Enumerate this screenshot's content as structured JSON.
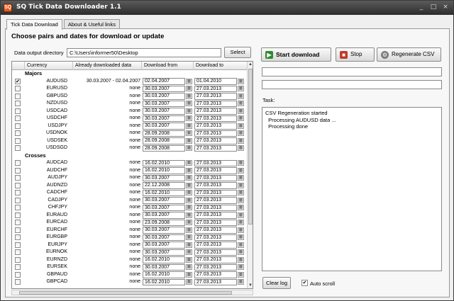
{
  "window": {
    "title": "SQ Tick Data Downloader 1.1",
    "app_icon": "SQ"
  },
  "window_controls": {
    "minimize": "_",
    "maximize": "□",
    "close": "×"
  },
  "tabs": [
    {
      "label": "Tick Data Download",
      "active": true
    },
    {
      "label": "About & Useful links",
      "active": false
    }
  ],
  "main": {
    "heading": "Choose pairs and dates for download or update",
    "output_dir_label": "Data output directory",
    "output_dir_value": "C:\\Users\\informer50\\Desktop",
    "select_button": "Select"
  },
  "grid": {
    "columns": [
      "Currency",
      "Already downloaded data",
      "Download from",
      "Download to"
    ],
    "groups": [
      {
        "name": "Majors",
        "rows": [
          {
            "checked": true,
            "currency": "AUDUSD",
            "downloaded": "30.03.2007 - 02.04.2007",
            "from": "02.04.2007",
            "to": "01.04.2010"
          },
          {
            "checked": false,
            "currency": "EURUSD",
            "downloaded": "none",
            "from": "30.03.2007",
            "to": "27.03.2013"
          },
          {
            "checked": false,
            "currency": "GBPUSD",
            "downloaded": "none",
            "from": "30.03.2007",
            "to": "27.03.2013"
          },
          {
            "checked": false,
            "currency": "NZDUSD",
            "downloaded": "none",
            "from": "30.03.2007",
            "to": "27.03.2013"
          },
          {
            "checked": false,
            "currency": "USDCAD",
            "downloaded": "none",
            "from": "30.03.2007",
            "to": "27.03.2013"
          },
          {
            "checked": false,
            "currency": "USDCHF",
            "downloaded": "none",
            "from": "30.03.2007",
            "to": "27.03.2013"
          },
          {
            "checked": false,
            "currency": "USDJPY",
            "downloaded": "none",
            "from": "30.03.2007",
            "to": "27.03.2013"
          },
          {
            "checked": false,
            "currency": "USDNOK",
            "downloaded": "none",
            "from": "28.09.2008",
            "to": "27.03.2013"
          },
          {
            "checked": false,
            "currency": "USDSEK",
            "downloaded": "none",
            "from": "28.09.2008",
            "to": "27.03.2013"
          },
          {
            "checked": false,
            "currency": "USDSGD",
            "downloaded": "none",
            "from": "28.09.2008",
            "to": "27.03.2013"
          }
        ]
      },
      {
        "name": "Crosses",
        "rows": [
          {
            "checked": false,
            "currency": "AUDCAD",
            "downloaded": "none",
            "from": "16.02.2010",
            "to": "27.03.2013"
          },
          {
            "checked": false,
            "currency": "AUDCHF",
            "downloaded": "none",
            "from": "16.02.2010",
            "to": "27.03.2013"
          },
          {
            "checked": false,
            "currency": "AUDJPY",
            "downloaded": "none",
            "from": "30.03.2007",
            "to": "27.03.2013"
          },
          {
            "checked": false,
            "currency": "AUDNZD",
            "downloaded": "none",
            "from": "22.12.2008",
            "to": "27.03.2013"
          },
          {
            "checked": false,
            "currency": "CADCHF",
            "downloaded": "none",
            "from": "16.02.2010",
            "to": "27.03.2013"
          },
          {
            "checked": false,
            "currency": "CADJPY",
            "downloaded": "none",
            "from": "30.03.2007",
            "to": "27.03.2013"
          },
          {
            "checked": false,
            "currency": "CHFJPY",
            "downloaded": "none",
            "from": "30.03.2007",
            "to": "27.03.2013"
          },
          {
            "checked": false,
            "currency": "EURAUD",
            "downloaded": "none",
            "from": "30.03.2007",
            "to": "27.03.2013"
          },
          {
            "checked": false,
            "currency": "EURCAD",
            "downloaded": "none",
            "from": "23.09.2008",
            "to": "27.03.2013"
          },
          {
            "checked": false,
            "currency": "EURCHF",
            "downloaded": "none",
            "from": "30.03.2007",
            "to": "27.03.2013"
          },
          {
            "checked": false,
            "currency": "EURGBP",
            "downloaded": "none",
            "from": "30.03.2007",
            "to": "27.03.2013"
          },
          {
            "checked": false,
            "currency": "EURJPY",
            "downloaded": "none",
            "from": "30.03.2007",
            "to": "27.03.2013"
          },
          {
            "checked": false,
            "currency": "EURNOK",
            "downloaded": "none",
            "from": "30.03.2007",
            "to": "27.03.2013"
          },
          {
            "checked": false,
            "currency": "EURNZD",
            "downloaded": "none",
            "from": "16.02.2010",
            "to": "27.03.2013"
          },
          {
            "checked": false,
            "currency": "EURSEK",
            "downloaded": "none",
            "from": "30.03.2007",
            "to": "27.03.2013"
          },
          {
            "checked": false,
            "currency": "GBPAUD",
            "downloaded": "none",
            "from": "16.02.2010",
            "to": "27.03.2013"
          },
          {
            "checked": false,
            "currency": "GBPCAD",
            "downloaded": "none",
            "from": "16.02.2010",
            "to": "27.03.2013"
          }
        ]
      }
    ]
  },
  "actions": {
    "start_label": "Start download",
    "stop_label": "Stop",
    "regen_label": "Regenerate CSV",
    "start_icon": "play-icon",
    "stop_icon": "stop-icon",
    "regen_icon": "gear-icon"
  },
  "progress": [
    {
      "value": 0
    },
    {
      "value": 0
    }
  ],
  "task": {
    "label": "Task:",
    "log_lines": [
      "CSV Regeneration started",
      "  Processing AUDUSD data ...",
      "  Processing done"
    ]
  },
  "bottom": {
    "clear_log": "Clear log",
    "auto_scroll_label": "Auto scroll",
    "auto_scroll_checked": true
  }
}
